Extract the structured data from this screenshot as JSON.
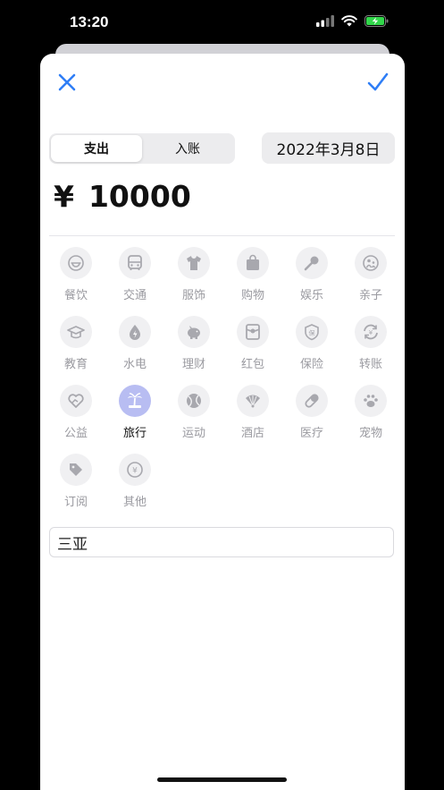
{
  "status_bar": {
    "time": "13:20"
  },
  "segmented": {
    "expense": "支出",
    "income": "入账"
  },
  "date": "2022年3月8日",
  "amount": {
    "currency": "¥",
    "value": "10000"
  },
  "categories": [
    {
      "label": "餐饮",
      "icon": "bowl-icon"
    },
    {
      "label": "交通",
      "icon": "bus-icon"
    },
    {
      "label": "服饰",
      "icon": "shirt-icon"
    },
    {
      "label": "购物",
      "icon": "shopping-bag-icon"
    },
    {
      "label": "娱乐",
      "icon": "microphone-icon"
    },
    {
      "label": "亲子",
      "icon": "family-icon"
    },
    {
      "label": "教育",
      "icon": "graduation-cap-icon"
    },
    {
      "label": "水电",
      "icon": "water-drop-icon"
    },
    {
      "label": "理财",
      "icon": "piggy-bank-icon"
    },
    {
      "label": "红包",
      "icon": "red-envelope-icon"
    },
    {
      "label": "保险",
      "icon": "shield-icon"
    },
    {
      "label": "转账",
      "icon": "transfer-icon"
    },
    {
      "label": "公益",
      "icon": "heart-hand-icon"
    },
    {
      "label": "旅行",
      "icon": "palm-tree-icon",
      "selected": true
    },
    {
      "label": "运动",
      "icon": "ball-icon"
    },
    {
      "label": "酒店",
      "icon": "fan-icon"
    },
    {
      "label": "医疗",
      "icon": "pill-icon"
    },
    {
      "label": "宠物",
      "icon": "paw-icon"
    },
    {
      "label": "订阅",
      "icon": "tag-icon"
    },
    {
      "label": "其他",
      "icon": "yen-coin-icon"
    }
  ],
  "note": {
    "value": "三亚"
  },
  "colors": {
    "accent": "#2f7ef6",
    "selected_bg": "#b8bdf2",
    "icon_gray": "#a8a8ae"
  }
}
